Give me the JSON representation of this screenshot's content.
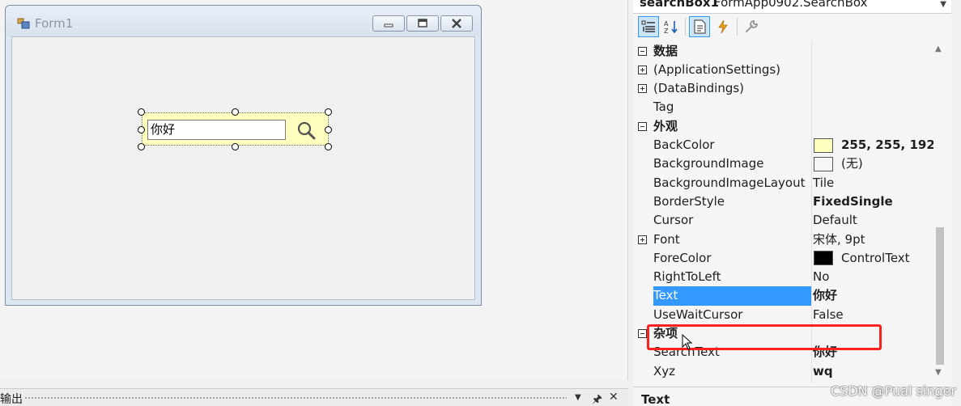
{
  "form": {
    "title": "Form1",
    "searchbox_text": "你好"
  },
  "props": {
    "object_name": "searchBox1",
    "object_type": "FormApp0902.SearchBox",
    "rows": [
      {
        "kind": "cat",
        "name": "数据",
        "value": ""
      },
      {
        "kind": "plus",
        "name": "(ApplicationSettings)",
        "value": ""
      },
      {
        "kind": "plus",
        "name": "(DataBindings)",
        "value": ""
      },
      {
        "kind": "prop",
        "name": "Tag",
        "value": ""
      },
      {
        "kind": "cat",
        "name": "外观",
        "value": ""
      },
      {
        "kind": "prop",
        "name": "BackColor",
        "value": "255, 255, 192",
        "bold": true,
        "swatch": "#ffffc0"
      },
      {
        "kind": "prop",
        "name": "BackgroundImage",
        "value": "(无)",
        "swatch": "#f6f6f6"
      },
      {
        "kind": "prop",
        "name": "BackgroundImageLayout",
        "value": "Tile"
      },
      {
        "kind": "prop",
        "name": "BorderStyle",
        "value": "FixedSingle",
        "bold": true
      },
      {
        "kind": "prop",
        "name": "Cursor",
        "value": "Default"
      },
      {
        "kind": "plus",
        "name": "Font",
        "value": "宋体, 9pt"
      },
      {
        "kind": "prop",
        "name": "ForeColor",
        "value": "ControlText",
        "swatch": "#000000"
      },
      {
        "kind": "prop",
        "name": "RightToLeft",
        "value": "No"
      },
      {
        "kind": "prop",
        "name": "Text",
        "value": "你好",
        "bold": true,
        "selected": true
      },
      {
        "kind": "prop",
        "name": "UseWaitCursor",
        "value": "False"
      },
      {
        "kind": "cat",
        "name": "杂项",
        "value": ""
      },
      {
        "kind": "prop",
        "name": "SearchText",
        "value": "你好",
        "bold": true
      },
      {
        "kind": "prop",
        "name": "Xyz",
        "value": "wq",
        "bold": true
      }
    ],
    "description_title": "Text"
  },
  "output": {
    "title": "输出"
  },
  "watermark": "CSDN @Pual singer",
  "colors": {
    "selection": "#3399ff",
    "highlight_border": "#ff2020",
    "searchbox_back": "#ffffc0"
  }
}
